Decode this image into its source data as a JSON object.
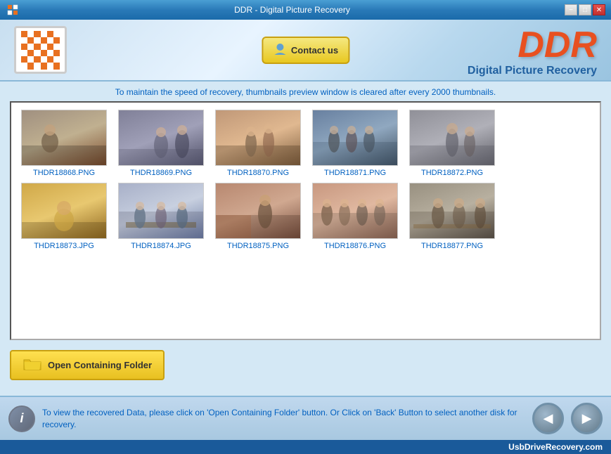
{
  "window": {
    "title": "DDR - Digital Picture Recovery",
    "controls": {
      "minimize": "−",
      "maximize": "□",
      "close": "✕"
    }
  },
  "header": {
    "contact_btn": "Contact us",
    "brand_ddr": "DDR",
    "brand_subtitle": "Digital Picture Recovery"
  },
  "info_message": "To maintain the speed of recovery, ",
  "info_message_link": "thumbnails preview window is cleared after every 2000 thumbnails.",
  "thumbnails": [
    {
      "filename": "THDR18868.PNG",
      "photo_class": "photo-1"
    },
    {
      "filename": "THDR18869.PNG",
      "photo_class": "photo-2"
    },
    {
      "filename": "THDR18870.PNG",
      "photo_class": "photo-3"
    },
    {
      "filename": "THDR18871.PNG",
      "photo_class": "photo-4"
    },
    {
      "filename": "THDR18872.PNG",
      "photo_class": "photo-5"
    },
    {
      "filename": "THDR18873.JPG",
      "photo_class": "photo-6"
    },
    {
      "filename": "THDR18874.JPG",
      "photo_class": "photo-7"
    },
    {
      "filename": "THDR18875.PNG",
      "photo_class": "photo-8"
    },
    {
      "filename": "THDR18876.PNG",
      "photo_class": "photo-9"
    },
    {
      "filename": "THDR18877.PNG",
      "photo_class": "photo-10"
    }
  ],
  "open_folder_btn": "Open Containing Folder",
  "bottom_info_text": "To view the recovered Data, please click on 'Open Containing Folder' button. Or Click on 'Back' Button to select another disk for recovery.",
  "footer_url": "UsbDriveRecovery.com"
}
